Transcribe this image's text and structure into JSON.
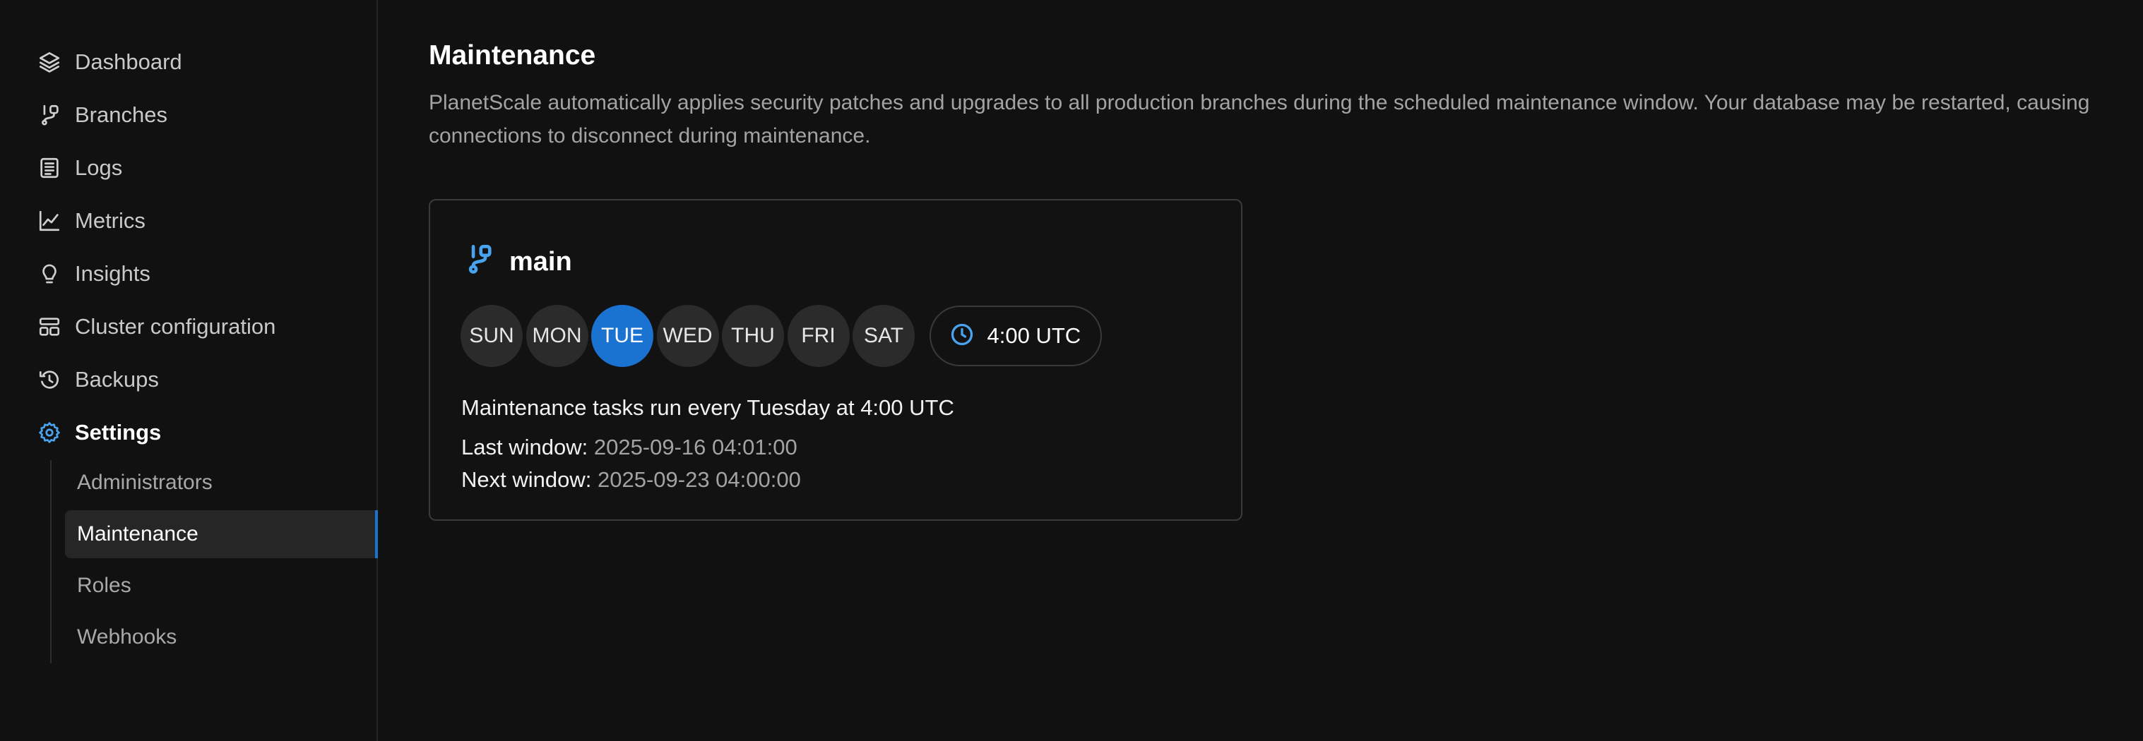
{
  "sidebar": {
    "items": [
      {
        "label": "Dashboard",
        "icon": "layers-icon"
      },
      {
        "label": "Branches",
        "icon": "branch-icon"
      },
      {
        "label": "Logs",
        "icon": "logs-icon"
      },
      {
        "label": "Metrics",
        "icon": "chart-line-icon"
      },
      {
        "label": "Insights",
        "icon": "lightbulb-icon"
      },
      {
        "label": "Cluster configuration",
        "icon": "cluster-icon"
      },
      {
        "label": "Backups",
        "icon": "history-icon"
      },
      {
        "label": "Settings",
        "icon": "gear-icon",
        "active": true
      }
    ],
    "settings_sub": [
      {
        "label": "Administrators"
      },
      {
        "label": "Maintenance",
        "active": true
      },
      {
        "label": "Roles"
      },
      {
        "label": "Webhooks"
      }
    ]
  },
  "main": {
    "title": "Maintenance",
    "description": "PlanetScale automatically applies security patches and upgrades to all production branches during the scheduled maintenance window. Your database may be restarted, causing connections to disconnect during maintenance.",
    "card": {
      "branch_name": "main",
      "days": [
        "SUN",
        "MON",
        "TUE",
        "WED",
        "THU",
        "FRI",
        "SAT"
      ],
      "selected_day": "TUE",
      "time": "4:00 UTC",
      "summary": "Maintenance tasks run every Tuesday at 4:00 UTC",
      "last_window_label": "Last window:",
      "last_window_value": "2025-09-16 04:01:00",
      "next_window_label": "Next window:",
      "next_window_value": "2025-09-23 04:00:00"
    }
  },
  "colors": {
    "background": "#111111",
    "accent": "#1a73d1",
    "icon_accent": "#4aa3ee"
  }
}
